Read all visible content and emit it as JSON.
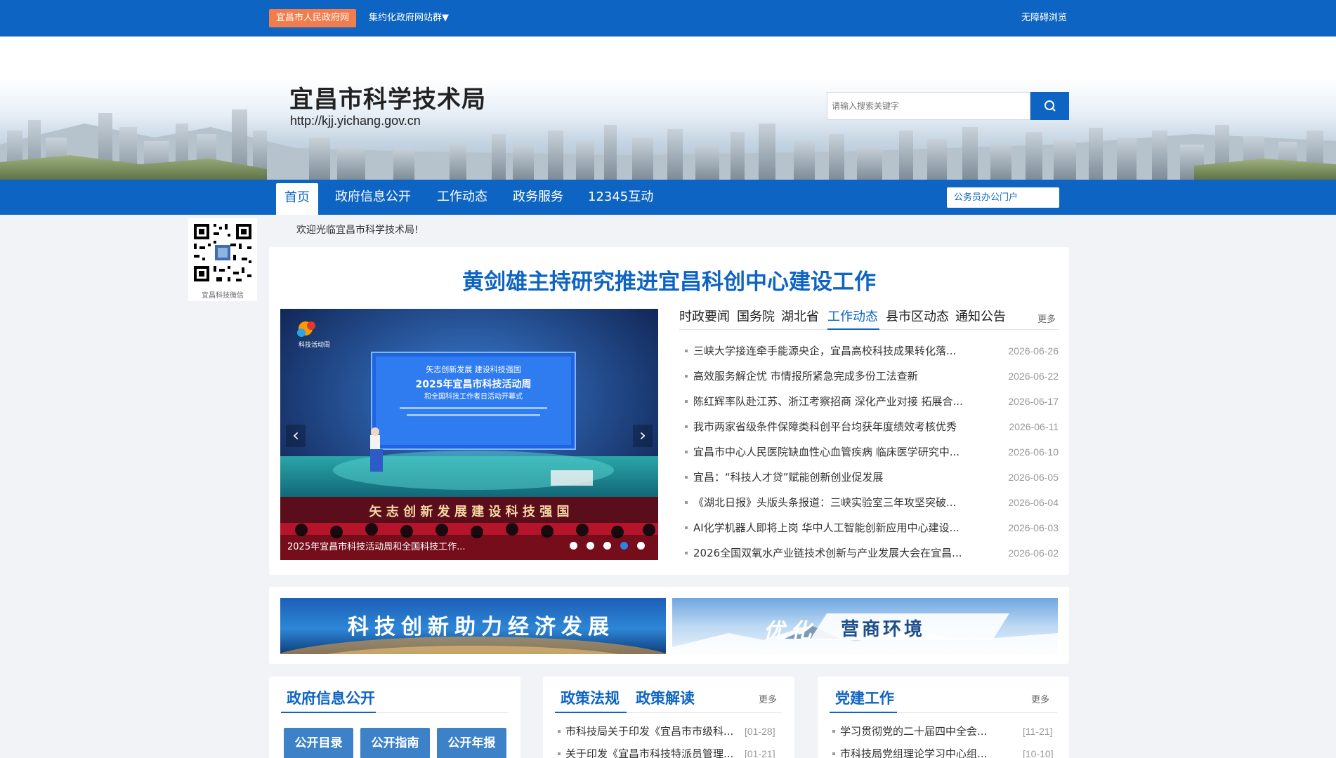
{
  "topbar": {
    "gov_tag": "宜昌市人民政府网",
    "site_group": "集约化政府网站群▼",
    "accessible": "无障碍浏览"
  },
  "banner": {
    "title": "宜昌市科学技术局",
    "url": "http://kjj.yichang.gov.cn",
    "search_placeholder": "请输入搜索关键字"
  },
  "nav": {
    "items": [
      "首页",
      "政府信息公开",
      "工作动态",
      "政务服务",
      "12345互动"
    ],
    "portal": "公务员办公门户"
  },
  "qr": {
    "label": "宜昌科技微信"
  },
  "welcome": "欢迎光临宜昌市科学技术局!",
  "headline": "黄剑雄主持研究推进宜昌科创中心建设工作",
  "slider": {
    "caption": "2025年宜昌市科技活动周和全国科技工作...",
    "active_dot": 4,
    "dot_count": 5,
    "screen_title": "2025年宜昌市科技活动周",
    "screen_subtitle": "和全国科技工作者日活动开幕式",
    "screen_slogan": "矢志创新发展 建设科技强国",
    "logo_text": "科技活动周",
    "stage_text": "矢 志 创 新 发 展   建 设 科 技 强 国"
  },
  "news": {
    "tabs": [
      "时政要闻",
      "国务院",
      "湖北省",
      "工作动态",
      "县市区动态",
      "通知公告"
    ],
    "active_tab": 3,
    "more": "更多",
    "items": [
      {
        "title": "三峡大学接连牵手能源央企，宜昌高校科技成果转化落...",
        "date": "2026-06-26"
      },
      {
        "title": "高效服务解企忧 市情报所紧急完成多份工法查新",
        "date": "2026-06-22"
      },
      {
        "title": "陈红辉率队赴江苏、浙江考察招商 深化产业对接 拓展合...",
        "date": "2026-06-17"
      },
      {
        "title": "我市两家省级条件保障类科创平台均获年度绩效考核优秀",
        "date": "2026-06-11"
      },
      {
        "title": "宜昌市中心人民医院缺血性心血管疾病 临床医学研究中...",
        "date": "2026-06-10"
      },
      {
        "title": "宜昌：“科技人才贷”赋能创新创业促发展",
        "date": "2026-06-05"
      },
      {
        "title": "《湖北日报》头版头条报道：三峡实验室三年攻坚突破...",
        "date": "2026-06-04"
      },
      {
        "title": "AI化学机器人即将上岗 华中人工智能创新应用中心建设...",
        "date": "2026-06-03"
      },
      {
        "title": "2026全国双氧水产业链技术创新与产业发展大会在宜昌...",
        "date": "2026-06-02"
      }
    ]
  },
  "promo": {
    "left": "科技创新助力经济发展",
    "right_a": "优化",
    "right_b": "营商环境"
  },
  "sections": {
    "gov_info": {
      "title": "政府信息公开",
      "buttons": [
        "公开目录",
        "公开指南",
        "公开年报"
      ]
    },
    "policy": {
      "title_a": "政策法规",
      "title_b": "政策解读",
      "more": "更多",
      "items": [
        {
          "title": "市科技局关于印发《宜昌市市级科...",
          "date": "[01-28]"
        },
        {
          "title": "关于印发《宜昌市科技特派员管理...",
          "date": "[01-21]"
        }
      ]
    },
    "party": {
      "title": "党建工作",
      "more": "更多",
      "items": [
        {
          "title": "学习贯彻党的二十届四中全会...",
          "date": "[11-21]"
        },
        {
          "title": "市科技局党组理论学习中心组...",
          "date": "[10-10]"
        }
      ]
    }
  },
  "colors": {
    "brand": "#0d64c2",
    "accent": "#f17c4c",
    "muted": "#999999"
  }
}
